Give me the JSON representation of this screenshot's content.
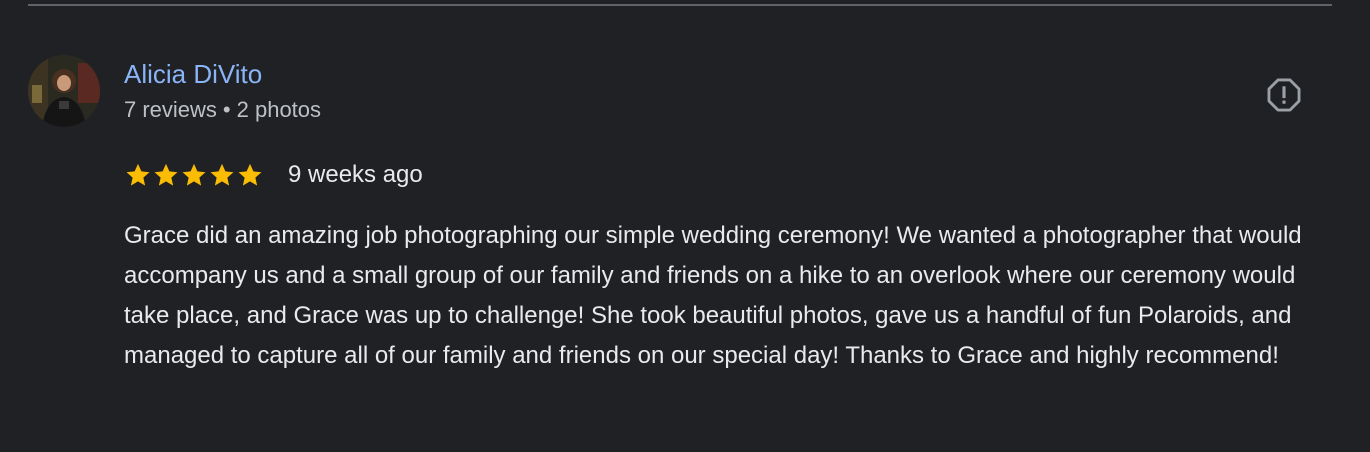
{
  "review": {
    "author": {
      "name": "Alicia DiVito",
      "reviews": "7 reviews",
      "separator": "•",
      "photos": "2 photos"
    },
    "rating": 5,
    "date": "9 weeks ago",
    "text": "Grace did an amazing job photographing our simple wedding ceremony! We wanted a photographer that would accompany us and a small group of our family and friends on a hike to an overlook where our ceremony would take place, and Grace was up to challenge! She took beautiful photos, gave us a handful of fun Polaroids, and managed to capture all of our family and friends on our special day! Thanks to Grace and highly recommend!"
  },
  "icons": {
    "flag": "report-flag-icon",
    "star": "star-icon"
  },
  "colors": {
    "background": "#202124",
    "author_link": "#8ab4f8",
    "star": "#fbbc04",
    "text": "#e8eaed",
    "secondary_text": "#bdc1c6",
    "icon": "#9aa0a6"
  }
}
